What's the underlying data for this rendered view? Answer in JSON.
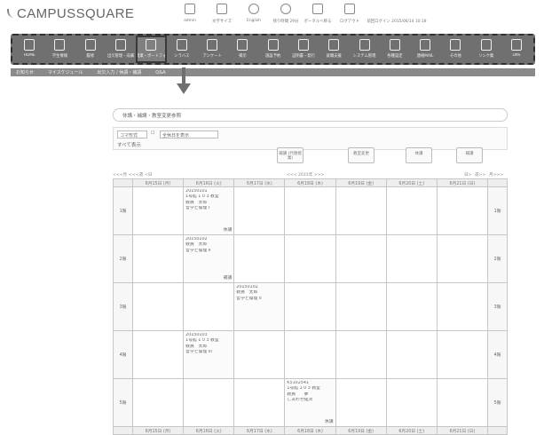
{
  "app": {
    "title": "CAMPUSSQUARE"
  },
  "header_tools": [
    {
      "icon": "person-icon",
      "label": "admin"
    },
    {
      "icon": "text-size-icon",
      "label": "文字サイズ"
    },
    {
      "icon": "globe-icon",
      "label": "English"
    },
    {
      "icon": "clock-icon",
      "label": "残り時間 29分"
    },
    {
      "icon": "portal-icon",
      "label": "ポータルへ移る"
    },
    {
      "icon": "logout-icon",
      "label": "ログアウト"
    },
    {
      "icon": "",
      "label": "前回ログイン 2015/06/14 10:18"
    }
  ],
  "toolbar": [
    {
      "icon": "home-icon",
      "label": "HOME",
      "selected": false
    },
    {
      "icon": "student-info-icon",
      "label": "学生情報",
      "selected": false
    },
    {
      "icon": "grades-icon",
      "label": "履修",
      "selected": false
    },
    {
      "icon": "attendance-icon",
      "label": "出欠管理・成績",
      "selected": false
    },
    {
      "icon": "lecture-icon",
      "label": "授業・ポートフォリオ",
      "selected": true
    },
    {
      "icon": "syllabus-icon",
      "label": "シラバス",
      "selected": false
    },
    {
      "icon": "survey-icon",
      "label": "アンケート",
      "selected": false
    },
    {
      "icon": "bulletin-icon",
      "label": "掲示",
      "selected": false
    },
    {
      "icon": "facility-icon",
      "label": "施設予約",
      "selected": false
    },
    {
      "icon": "certificate-icon",
      "label": "証明書・発行",
      "selected": false
    },
    {
      "icon": "job-icon",
      "label": "就職支援",
      "selected": false
    },
    {
      "icon": "system-icon",
      "label": "システム管理",
      "selected": false
    },
    {
      "icon": "settings-icon",
      "label": "各種設定",
      "selected": false
    },
    {
      "icon": "mail-icon",
      "label": "連絡MAIL",
      "selected": false
    },
    {
      "icon": "other-icon",
      "label": "その他",
      "selected": false
    },
    {
      "icon": "links-icon",
      "label": "リンク集",
      "selected": false
    },
    {
      "icon": "lms-icon",
      "label": "LMS",
      "selected": false
    }
  ],
  "subbar": [
    "お知らせ",
    "マイスケジュール",
    "出欠入力 / 休講・補講",
    "Q&A"
  ],
  "search_title": "休講・補講・教室変更参照",
  "controls": {
    "view_select": "コマ形式",
    "checkbox_label": "全休日を表示",
    "showall": "すべて表示"
  },
  "buttons": {
    "register": "補講\n(代替授業)",
    "room_change": "教室変更",
    "cancel": "休講",
    "makeup": "補講"
  },
  "nav": {
    "prev_month": "<<<月",
    "prev_week": "<<<週",
    "prev_day": "<日",
    "year": "<<< 2015年 >>>",
    "next_day": "日>",
    "next_week": "週>>",
    "next_month": "月>>>"
  },
  "days": [
    "6月15日 (月)",
    "6月16日 (火)",
    "6月17日 (水)",
    "6月18日 (木)",
    "6月19日 (金)",
    "6月20日 (土)",
    "6月21日 (日)"
  ],
  "periods": [
    "1限",
    "2限",
    "3限",
    "4限",
    "5限"
  ],
  "events": {
    "1-1": [
      "20150101",
      "1号館 1 0 3 教室",
      "教員　太郎",
      "",
      "哲学と倫理 I",
      "休講"
    ],
    "2-1": [
      "20150102",
      "",
      "教員　太郎",
      "",
      "哲学と倫理 II",
      "補講"
    ],
    "3-2": [
      "20150102",
      "",
      "教員　太郎",
      "",
      "哲学と倫理 II",
      ""
    ],
    "4-1": [
      "20150103",
      "1号館 1 0 3 教室",
      "教員　太郎",
      "",
      "哲学と倫理 III",
      ""
    ],
    "5-3": [
      "K5102541",
      "1号館 1 0 3 教室",
      "教員　　夢",
      "",
      "しあわせ経済",
      "休講"
    ]
  }
}
